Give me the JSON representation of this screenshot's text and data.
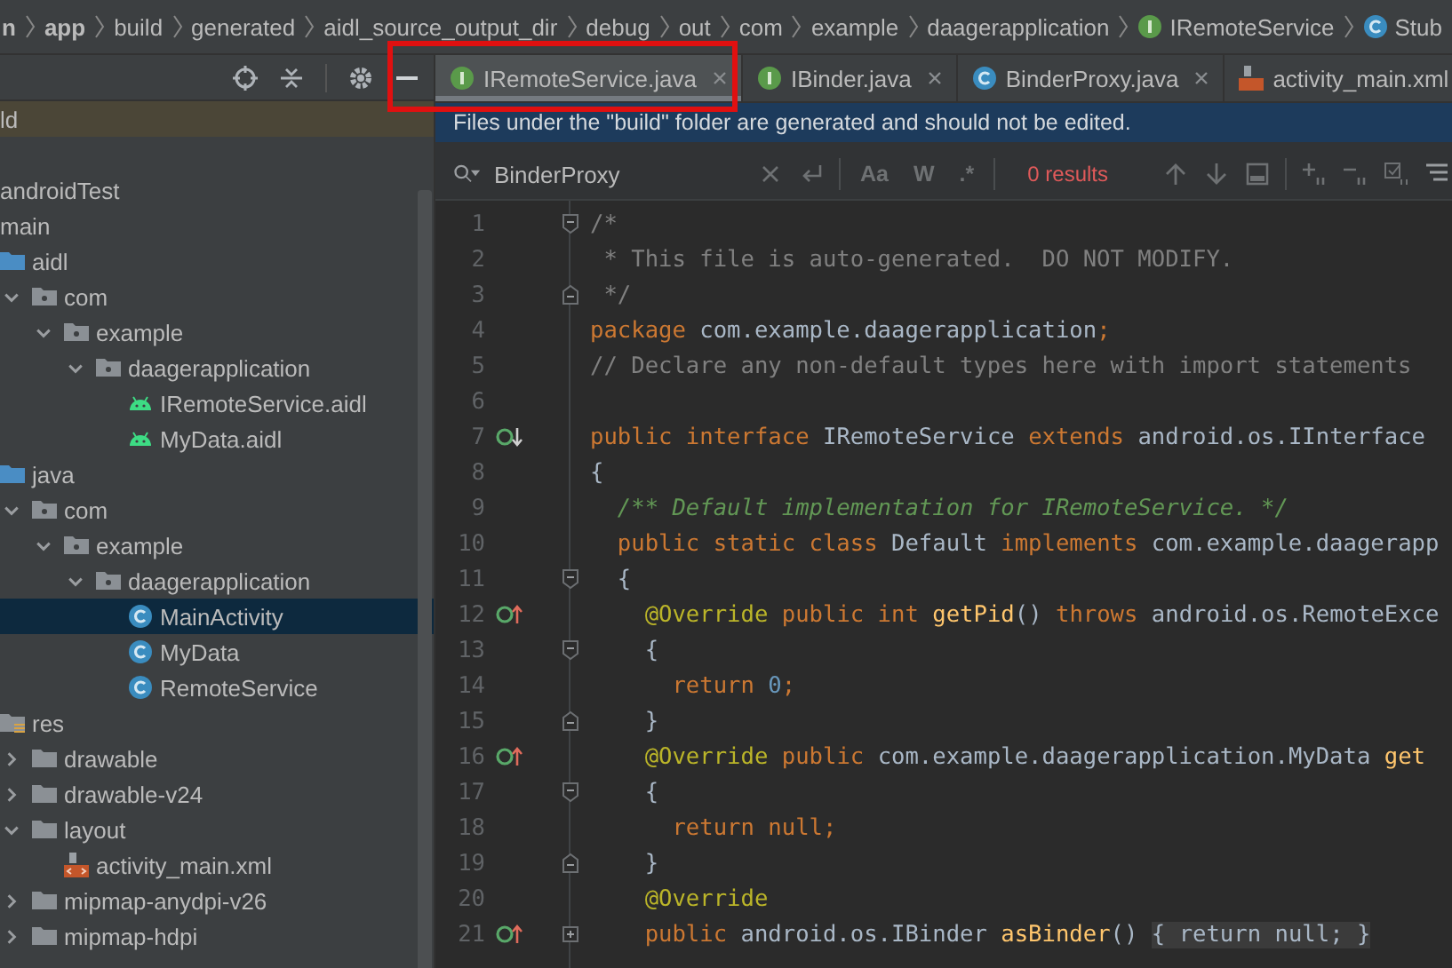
{
  "breadcrumb": [
    {
      "kind": "module",
      "label": "n"
    },
    {
      "kind": "module",
      "label": "app"
    },
    {
      "kind": "folder",
      "label": "build"
    },
    {
      "kind": "folder",
      "label": "generated"
    },
    {
      "kind": "folder",
      "label": "aidl_source_output_dir"
    },
    {
      "kind": "folder",
      "label": "debug"
    },
    {
      "kind": "folder",
      "label": "out"
    },
    {
      "kind": "folder",
      "label": "com"
    },
    {
      "kind": "folder",
      "label": "example"
    },
    {
      "kind": "folder",
      "label": "daagerapplication"
    },
    {
      "kind": "interface",
      "label": "IRemoteService"
    },
    {
      "kind": "class",
      "label": "Stub"
    }
  ],
  "project_panel": {
    "root_row": {
      "label": "ld"
    },
    "tree": [
      {
        "kind": "folder",
        "label": "androidTest"
      },
      {
        "kind": "folder",
        "label": "main",
        "children": [
          {
            "kind": "source-folder",
            "label": "aidl",
            "children": [
              {
                "kind": "package",
                "label": "com",
                "expanded": true,
                "children": [
                  {
                    "kind": "package",
                    "label": "example",
                    "expanded": true,
                    "children": [
                      {
                        "kind": "package",
                        "label": "daagerapplication",
                        "expanded": true,
                        "children": [
                          {
                            "kind": "aidl-file",
                            "label": "IRemoteService.aidl",
                            "selected": false
                          },
                          {
                            "kind": "aidl-file",
                            "label": "MyData.aidl",
                            "selected": false
                          }
                        ]
                      }
                    ]
                  }
                ]
              }
            ]
          },
          {
            "kind": "source-folder",
            "label": "java",
            "children": [
              {
                "kind": "package",
                "label": "com",
                "expanded": true,
                "children": [
                  {
                    "kind": "package",
                    "label": "example",
                    "expanded": true,
                    "children": [
                      {
                        "kind": "package",
                        "label": "daagerapplication",
                        "expanded": true,
                        "children": [
                          {
                            "kind": "class",
                            "label": "MainActivity",
                            "selected": true
                          },
                          {
                            "kind": "class",
                            "label": "MyData",
                            "selected": false
                          },
                          {
                            "kind": "class",
                            "label": "RemoteService",
                            "selected": false
                          }
                        ]
                      }
                    ]
                  }
                ]
              }
            ]
          },
          {
            "kind": "res-folder",
            "label": "res",
            "children": [
              {
                "kind": "folder",
                "label": "drawable",
                "expanded": false
              },
              {
                "kind": "folder",
                "label": "drawable-v24",
                "expanded": false
              },
              {
                "kind": "folder",
                "label": "layout",
                "expanded": true,
                "children": [
                  {
                    "kind": "layout-file",
                    "label": "activity_main.xml",
                    "selected": false
                  }
                ]
              },
              {
                "kind": "folder",
                "label": "mipmap-anydpi-v26",
                "expanded": false
              },
              {
                "kind": "folder",
                "label": "mipmap-hdpi",
                "expanded": false
              }
            ]
          }
        ]
      }
    ]
  },
  "tabs": [
    {
      "kind": "interface",
      "label": "IRemoteService.java",
      "selected": true
    },
    {
      "kind": "interface",
      "label": "IBinder.java",
      "selected": false
    },
    {
      "kind": "class",
      "label": "BinderProxy.java",
      "selected": false
    },
    {
      "kind": "xml",
      "label": "activity_main.xml",
      "selected": false
    }
  ],
  "banner": "Files under the \"build\" folder are generated and should not be edited.",
  "search": {
    "value": "BinderProxy",
    "options": [
      "Aa",
      "W",
      ".*"
    ],
    "results": "0 results"
  },
  "code_lines": [
    {
      "n": "1",
      "fold": {
        "kind": "open"
      },
      "tokens": [
        {
          "kind": "comment",
          "t": "/*"
        }
      ]
    },
    {
      "n": "2",
      "tokens": [
        {
          "kind": "comment",
          "t": " * This file is auto-generated.  DO NOT MODIFY."
        }
      ]
    },
    {
      "n": "3",
      "fold": {
        "kind": "close"
      },
      "tokens": [
        {
          "kind": "comment",
          "t": " */"
        }
      ]
    },
    {
      "n": "4",
      "tokens": [
        {
          "kind": "kw",
          "t": "package"
        },
        {
          "kind": "plain",
          "t": " com.example.daagerapplication"
        },
        {
          "kind": "kw",
          "t": ";"
        }
      ]
    },
    {
      "n": "5",
      "tokens": [
        {
          "kind": "comment",
          "t": "// Declare any non-default types here with import statements"
        }
      ]
    },
    {
      "n": "6"
    },
    {
      "n": "7",
      "gutter": {
        "kind": "implemented"
      },
      "tokens": [
        {
          "kind": "kw",
          "t": "public interface"
        },
        {
          "kind": "plain",
          "t": " IRemoteService "
        },
        {
          "kind": "kw",
          "t": "extends"
        },
        {
          "kind": "plain",
          "t": " android.os.IInterface"
        }
      ]
    },
    {
      "n": "8",
      "tokens": [
        {
          "kind": "plain",
          "t": "{"
        }
      ]
    },
    {
      "n": "9",
      "tokens": [
        {
          "kind": "doc",
          "t": "  /** Default implementation for IRemoteService. */"
        }
      ]
    },
    {
      "n": "10",
      "tokens": [
        {
          "kind": "kw",
          "t": "  public static class"
        },
        {
          "kind": "plain",
          "t": " Default "
        },
        {
          "kind": "kw",
          "t": "implements"
        },
        {
          "kind": "plain",
          "t": " com.example.daagerapp"
        }
      ]
    },
    {
      "n": "11",
      "fold": {
        "kind": "open"
      },
      "tokens": [
        {
          "kind": "plain",
          "t": "  {"
        }
      ]
    },
    {
      "n": "12",
      "gutter": {
        "kind": "overrides"
      },
      "tokens": [
        {
          "kind": "ann",
          "t": "    @Override"
        },
        {
          "kind": "kw",
          "t": " public int "
        },
        {
          "kind": "method",
          "t": "getPid"
        },
        {
          "kind": "plain",
          "t": "() "
        },
        {
          "kind": "kw",
          "t": "throws"
        },
        {
          "kind": "plain",
          "t": " android.os.RemoteExce"
        }
      ]
    },
    {
      "n": "13",
      "fold": {
        "kind": "open"
      },
      "tokens": [
        {
          "kind": "plain",
          "t": "    {"
        }
      ]
    },
    {
      "n": "14",
      "tokens": [
        {
          "kind": "kw",
          "t": "      return "
        },
        {
          "kind": "num",
          "t": "0"
        },
        {
          "kind": "kw",
          "t": ";"
        }
      ]
    },
    {
      "n": "15",
      "fold": {
        "kind": "close"
      },
      "tokens": [
        {
          "kind": "plain",
          "t": "    }"
        }
      ]
    },
    {
      "n": "16",
      "gutter": {
        "kind": "overrides"
      },
      "tokens": [
        {
          "kind": "ann",
          "t": "    @Override"
        },
        {
          "kind": "kw",
          "t": " public"
        },
        {
          "kind": "plain",
          "t": " com.example.daagerapplication.MyData "
        },
        {
          "kind": "method",
          "t": "get"
        }
      ]
    },
    {
      "n": "17",
      "fold": {
        "kind": "open"
      },
      "tokens": [
        {
          "kind": "plain",
          "t": "    {"
        }
      ]
    },
    {
      "n": "18",
      "tokens": [
        {
          "kind": "kw",
          "t": "      return null;"
        }
      ]
    },
    {
      "n": "19",
      "fold": {
        "kind": "close"
      },
      "tokens": [
        {
          "kind": "plain",
          "t": "    }"
        }
      ]
    },
    {
      "n": "20",
      "tokens": [
        {
          "kind": "ann",
          "t": "    @Override"
        }
      ]
    },
    {
      "n": "21",
      "gutter": {
        "kind": "overrides"
      },
      "fold": {
        "kind": "collapsed"
      },
      "tokens": [
        {
          "kind": "kw",
          "t": "    public"
        },
        {
          "kind": "plain",
          "t": " android.os.IBinder "
        },
        {
          "kind": "method",
          "t": "asBinder"
        },
        {
          "kind": "plain",
          "t": "() "
        },
        {
          "kind": "folded",
          "t": "{ return null; }"
        }
      ]
    }
  ]
}
